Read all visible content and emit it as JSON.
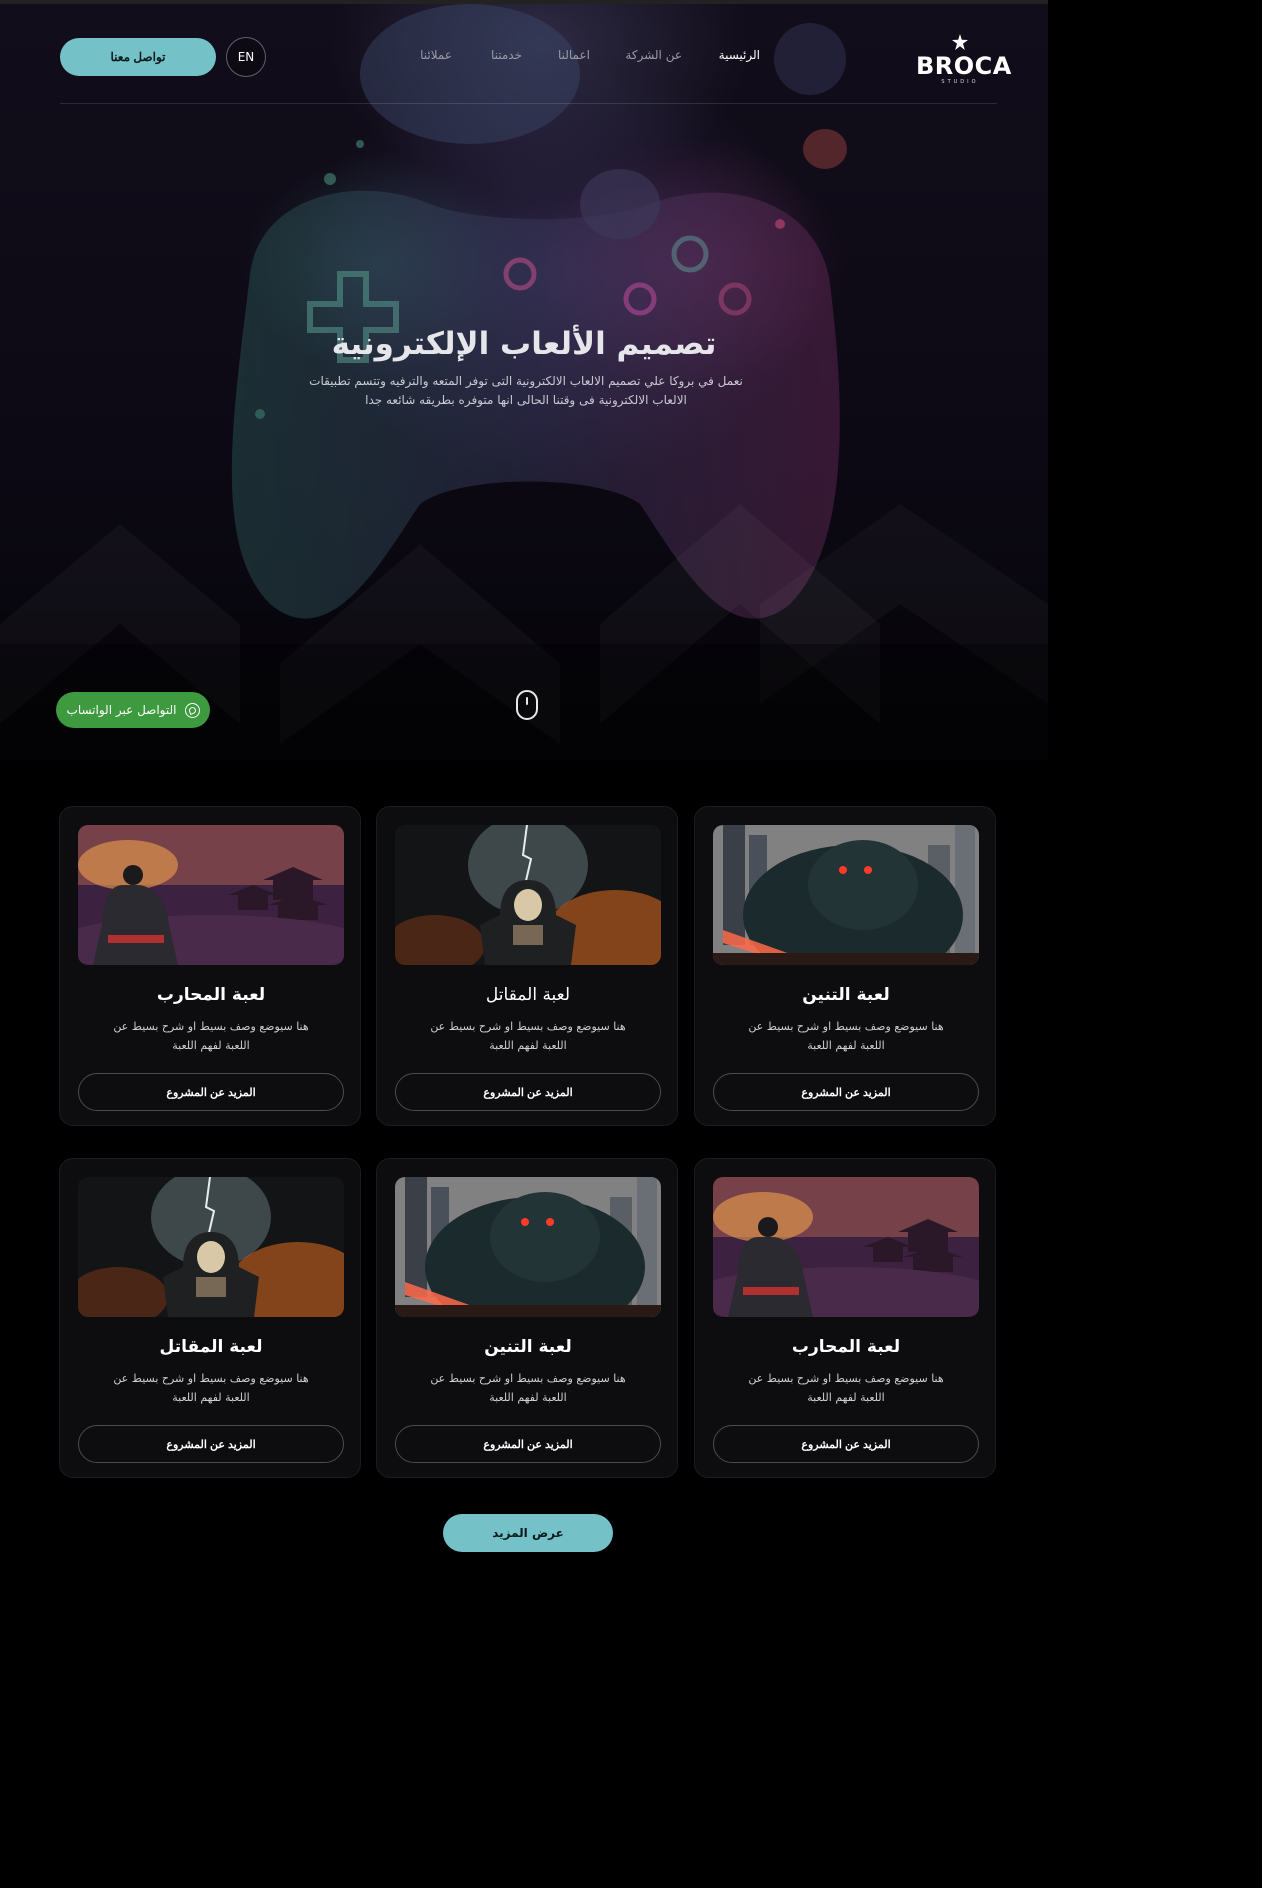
{
  "nav": {
    "logo_text": "BROCA",
    "logo_sub": "STUDIO",
    "links": [
      {
        "label": "الرئيسية",
        "active": true
      },
      {
        "label": "عن الشركة",
        "active": false
      },
      {
        "label": "اعمالنا",
        "active": false
      },
      {
        "label": "خدمتنا",
        "active": false
      },
      {
        "label": "عملائنا",
        "active": false
      }
    ],
    "lang_label": "EN",
    "contact_label": "تواصل معنا"
  },
  "hero": {
    "title": "تصميم الألعاب الإلكترونية",
    "description": "نعمل في بروكا علي تصميم الالعاب الالكترونية التى توفر المتعه والترفيه وتتسم تطبيقات الالعاب الالكترونية فى وقتنا الحالى انها متوفره بطريقه شائعه جدا",
    "whatsapp_label": "التواصل عبر الواتساب",
    "scroll_icon": "mouse-icon"
  },
  "cards": [
    {
      "title": "لعبة التنين",
      "description": "هنا سيوضع وصف بسيط او شرح بسيط عن اللعبة لفهم اللعبة",
      "button": "المزيد عن المشروع",
      "image": "beast-city"
    },
    {
      "title": "لعبة المقاتل",
      "description": "هنا سيوضع وصف بسيط او شرح بسيط عن اللعبة لفهم اللعبة",
      "button": "المزيد عن المشروع",
      "image": "dark-warrior"
    },
    {
      "title": "لعبة المحارب",
      "description": "هنا سيوضع وصف بسيط او شرح بسيط عن اللعبة لفهم اللعبة",
      "button": "المزيد عن المشروع",
      "image": "samurai-temple"
    },
    {
      "title": "لعبة المحارب",
      "description": "هنا سيوضع وصف بسيط او شرح بسيط عن اللعبة لفهم اللعبة",
      "button": "المزيد عن المشروع",
      "image": "samurai-temple"
    },
    {
      "title": "لعبة التنين",
      "description": "هنا سيوضع وصف بسيط او شرح بسيط عن اللعبة لفهم اللعبة",
      "button": "المزيد عن المشروع",
      "image": "beast-city"
    },
    {
      "title": "لعبة المقاتل",
      "description": "هنا سيوضع وصف بسيط او شرح بسيط عن اللعبة لفهم اللعبة",
      "button": "المزيد عن المشروع",
      "image": "dark-warrior"
    }
  ],
  "more_label": "عرض المزيد",
  "colors": {
    "accent": "#74c1c7",
    "whatsapp": "#3d9a3f",
    "background": "#000000",
    "card": "#0d0d0f"
  }
}
